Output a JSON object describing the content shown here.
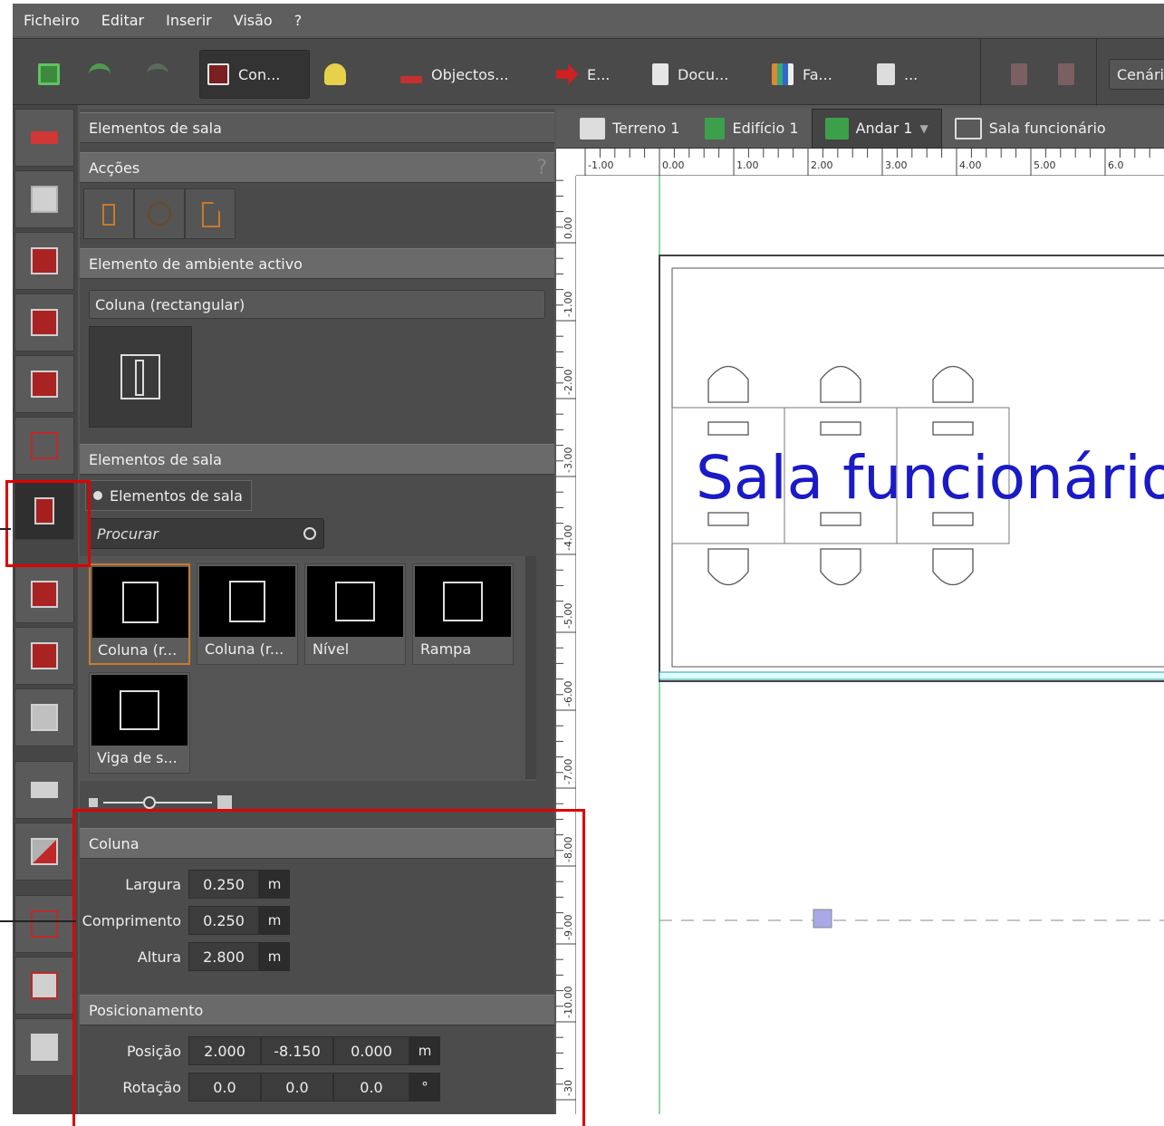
{
  "menu": [
    "Ficheiro",
    "Editar",
    "Inserir",
    "Visão",
    "?"
  ],
  "toolbar": {
    "construction_label": "Con...",
    "objects_label": "Objectos...",
    "export_label": "E...",
    "documents_label": "Docu...",
    "facades_label": "Fa...",
    "more_label": "...",
    "scenario_label": "Cenári"
  },
  "panel": {
    "title": "Elementos de sala",
    "actions_header": "Acções",
    "help": "?",
    "active_element_header": "Elemento de ambiente activo",
    "active_element_name": "Coluna (rectangular)",
    "room_elements_header": "Elementos de sala",
    "room_elements_tab": "Elementos de sala",
    "search_placeholder": "Procurar",
    "catalog": [
      {
        "label": "Coluna (r..."
      },
      {
        "label": "Coluna (r..."
      },
      {
        "label": "Nível"
      },
      {
        "label": "Rampa"
      },
      {
        "label": "Viga de s..."
      }
    ],
    "column_header": "Coluna",
    "width_label": "Largura",
    "width_value": "0.250",
    "length_label": "Comprimento",
    "length_value": "0.250",
    "height_label": "Altura",
    "height_value": "2.800",
    "unit_m": "m",
    "positioning_header": "Posicionamento",
    "position_label": "Posição",
    "position_x": "2.000",
    "position_y": "-8.150",
    "position_z": "0.000",
    "rotation_label": "Rotação",
    "rotation_x": "0.0",
    "rotation_y": "0.0",
    "rotation_z": "0.0",
    "unit_deg": "°"
  },
  "view_tabs": {
    "terrain": "Terreno 1",
    "building": "Edifício 1",
    "floor": "Andar 1",
    "room": "Sala funcionário"
  },
  "ruler_top": [
    "-1.00",
    "0.00",
    "1.00",
    "2.00",
    "3.00",
    "4.00",
    "5.00",
    "6.0"
  ],
  "ruler_left": [
    "0.00",
    "-1.00",
    "-2.00",
    "-3.00",
    "-4.00",
    "-5.00",
    "-6.00",
    "-7.00",
    "-8.00",
    "-9.00",
    "-10.00",
    "-30"
  ],
  "room_label": "Sala funcionário",
  "colors": {
    "accent_red": "#e00000",
    "room_text": "#1a1ac8",
    "selection": "#a9a9e8"
  }
}
